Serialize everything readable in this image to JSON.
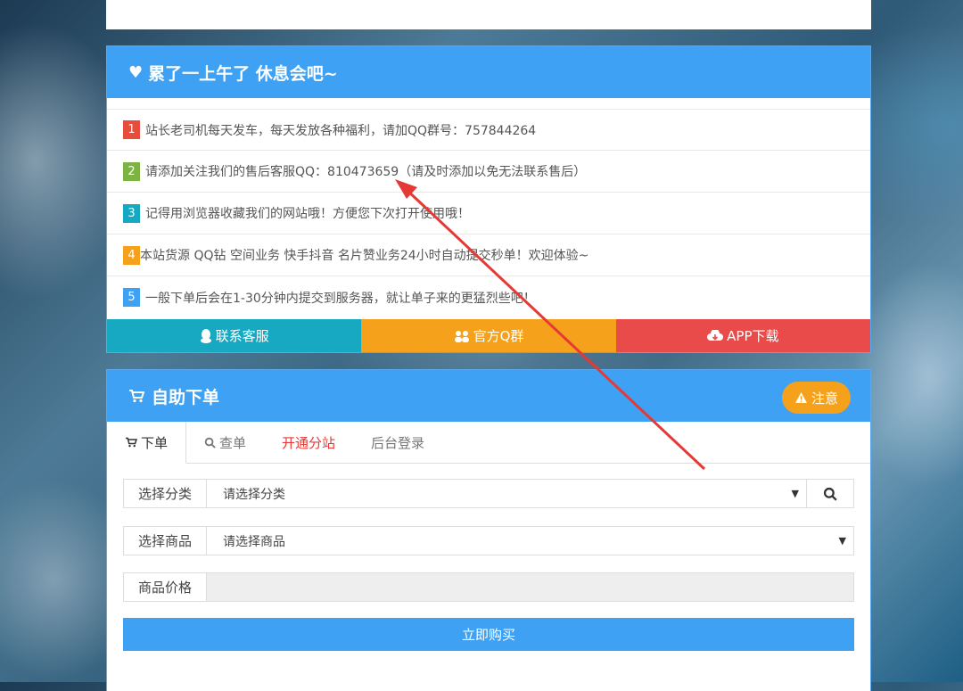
{
  "notice": {
    "title": "累了一上午了 休息会吧~",
    "items": [
      {
        "num": "1",
        "color": "#e74c3c",
        "text": "站长老司机每天发车，每天发放各种福利，请加QQ群号：757844264"
      },
      {
        "num": "2",
        "color": "#7cb342",
        "text": "请添加关注我们的售后客服QQ：810473659（请及时添加以免无法联系售后）"
      },
      {
        "num": "3",
        "color": "#17a9c2",
        "text": "记得用浏览器收藏我们的网站哦！方便您下次打开使用哦！"
      },
      {
        "num": "4",
        "color": "#f6a11b",
        "text": "本站货源 QQ钻 空间业务 快手抖音 名片赞业务24小时自动提交秒单！欢迎体验~"
      },
      {
        "num": "5",
        "color": "#3fa1f3",
        "text": "一般下单后会在1-30分钟内提交到服务器，就让单子来的更猛烈些吧！"
      }
    ],
    "buttons": [
      {
        "label": "联系客服",
        "color": "#17a9c2",
        "icon": "qq-penguin-icon"
      },
      {
        "label": "官方Q群",
        "color": "#f6a11b",
        "icon": "users-icon"
      },
      {
        "label": "APP下载",
        "color": "#e94b4b",
        "icon": "cloud-download-icon"
      }
    ]
  },
  "order": {
    "title": "自助下单",
    "warn_label": "注意",
    "tabs": [
      {
        "label": "下单",
        "icon": "cart-icon"
      },
      {
        "label": "查单",
        "icon": "search-icon"
      },
      {
        "label": "开通分站",
        "color": "#e53935"
      },
      {
        "label": "后台登录"
      }
    ],
    "category_label": "选择分类",
    "category_value": "请选择分类",
    "goods_label": "选择商品",
    "goods_value": "请选择商品",
    "price_label": "商品价格",
    "price_value": "",
    "buy_label": "立即购买"
  }
}
